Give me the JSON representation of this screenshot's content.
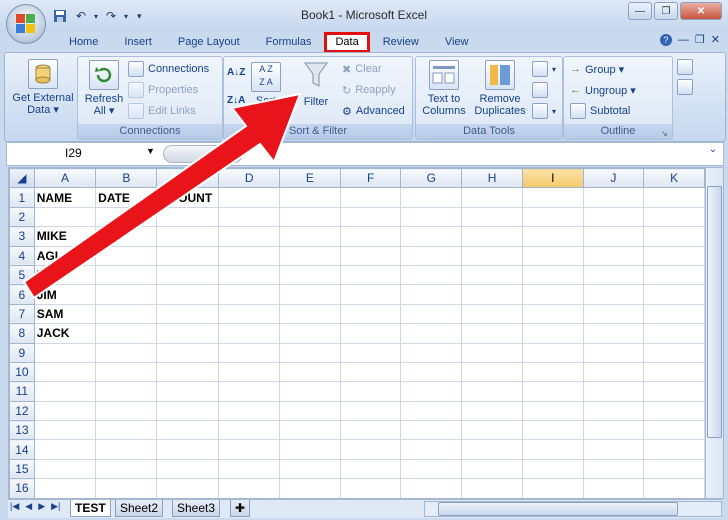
{
  "window": {
    "title": "Book1 - Microsoft Excel"
  },
  "tabs": [
    {
      "label": "Home"
    },
    {
      "label": "Insert"
    },
    {
      "label": "Page Layout"
    },
    {
      "label": "Formulas"
    },
    {
      "label": "Data",
      "active": true
    },
    {
      "label": "Review"
    },
    {
      "label": "View"
    }
  ],
  "ribbon": {
    "get_external": {
      "line1": "Get External",
      "line2": "Data ▾"
    },
    "refresh": {
      "line1": "Refresh",
      "line2": "All ▾"
    },
    "connections_group": {
      "connections": "Connections",
      "properties": "Properties",
      "edit_links": "Edit Links",
      "label": "Connections"
    },
    "sort_filter_group": {
      "sort": "Sort",
      "filter": "Filter",
      "clear": "Clear",
      "reapply": "Reapply",
      "advanced": "Advanced",
      "label": "Sort & Filter"
    },
    "data_tools_group": {
      "text_to_columns_1": "Text to",
      "text_to_columns_2": "Columns",
      "remove_dup_1": "Remove",
      "remove_dup_2": "Duplicates",
      "label": "Data Tools"
    },
    "outline_group": {
      "group": "Group ▾",
      "ungroup": "Ungroup ▾",
      "subtotal": "Subtotal",
      "label": "Outline"
    }
  },
  "name_box": {
    "value": "I29"
  },
  "columns": [
    "A",
    "B",
    "C",
    "D",
    "E",
    "F",
    "G",
    "H",
    "I",
    "J",
    "K"
  ],
  "selected_column": "I",
  "rows": [
    {
      "n": "1",
      "cells": [
        "NAME",
        "DATE",
        "AMOUNT"
      ]
    },
    {
      "n": "2",
      "cells": []
    },
    {
      "n": "3",
      "cells": [
        "MIKE"
      ]
    },
    {
      "n": "4",
      "cells": [
        "AGI"
      ]
    },
    {
      "n": "5",
      "cells": [
        "TOM"
      ]
    },
    {
      "n": "6",
      "cells": [
        "JIM"
      ]
    },
    {
      "n": "7",
      "cells": [
        "SAM"
      ]
    },
    {
      "n": "8",
      "cells": [
        "JACK"
      ]
    },
    {
      "n": "9",
      "cells": []
    },
    {
      "n": "10",
      "cells": []
    },
    {
      "n": "11",
      "cells": []
    },
    {
      "n": "12",
      "cells": []
    },
    {
      "n": "13",
      "cells": []
    },
    {
      "n": "14",
      "cells": []
    },
    {
      "n": "15",
      "cells": []
    },
    {
      "n": "16",
      "cells": []
    },
    {
      "n": "17",
      "cells": []
    }
  ],
  "sheets": [
    {
      "label": "TEST",
      "active": true
    },
    {
      "label": "Sheet2"
    },
    {
      "label": "Sheet3"
    }
  ],
  "colors": {
    "annotation": "#e8141a",
    "selected_header": "#f5c76a",
    "ribbon": "#dce7f5"
  }
}
